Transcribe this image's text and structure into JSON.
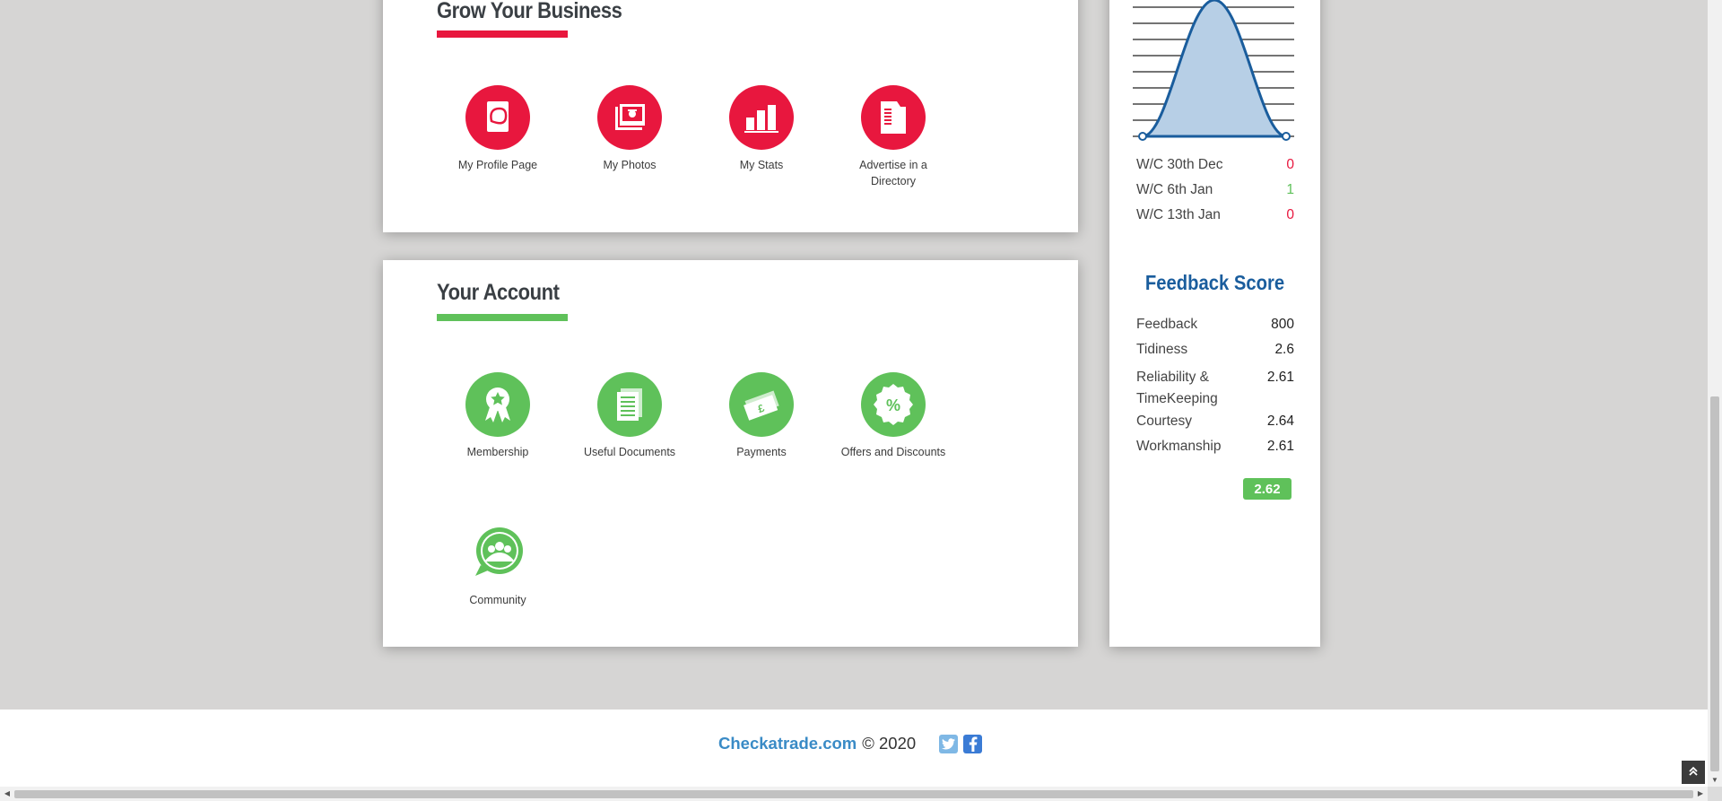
{
  "grow": {
    "title": "Grow Your Business",
    "tiles": [
      {
        "label": "My Profile Page",
        "icon": "profile-page-icon"
      },
      {
        "label": "My Photos",
        "icon": "photos-icon"
      },
      {
        "label": "My Stats",
        "icon": "stats-icon"
      },
      {
        "label": "Advertise in a Directory",
        "icon": "directory-icon"
      }
    ]
  },
  "account": {
    "title": "Your Account",
    "tiles": [
      {
        "label": "Membership",
        "icon": "membership-badge-icon"
      },
      {
        "label": "Useful Documents",
        "icon": "documents-icon"
      },
      {
        "label": "Payments",
        "icon": "payments-icon"
      },
      {
        "label": "Offers and Discounts",
        "icon": "discount-icon"
      },
      {
        "label": "Community",
        "icon": "community-icon"
      }
    ]
  },
  "stats": {
    "weeks": [
      {
        "label": "W/C 30th Dec",
        "value": "0",
        "status": "red"
      },
      {
        "label": "W/C 6th Jan",
        "value": "1",
        "status": "green"
      },
      {
        "label": "W/C 13th Jan",
        "value": "0",
        "status": "red"
      }
    ]
  },
  "feedback": {
    "title": "Feedback Score",
    "rows": [
      {
        "label": "Feedback",
        "value": "800"
      },
      {
        "label": "Tidiness",
        "value": "2.6"
      },
      {
        "label": "Reliability & TimeKeeping",
        "value": "2.61"
      },
      {
        "label": "Courtesy",
        "value": "2.64"
      },
      {
        "label": "Workmanship",
        "value": "2.61"
      }
    ],
    "overall": "2.62"
  },
  "footer": {
    "brand": "Checkatrade.com",
    "copyright": "© 2020"
  },
  "colors": {
    "grow_accent": "#e8173e",
    "account_accent": "#5fc15a",
    "feedback_title": "#1a5d9d",
    "brand_link": "#3a8bc6"
  }
}
